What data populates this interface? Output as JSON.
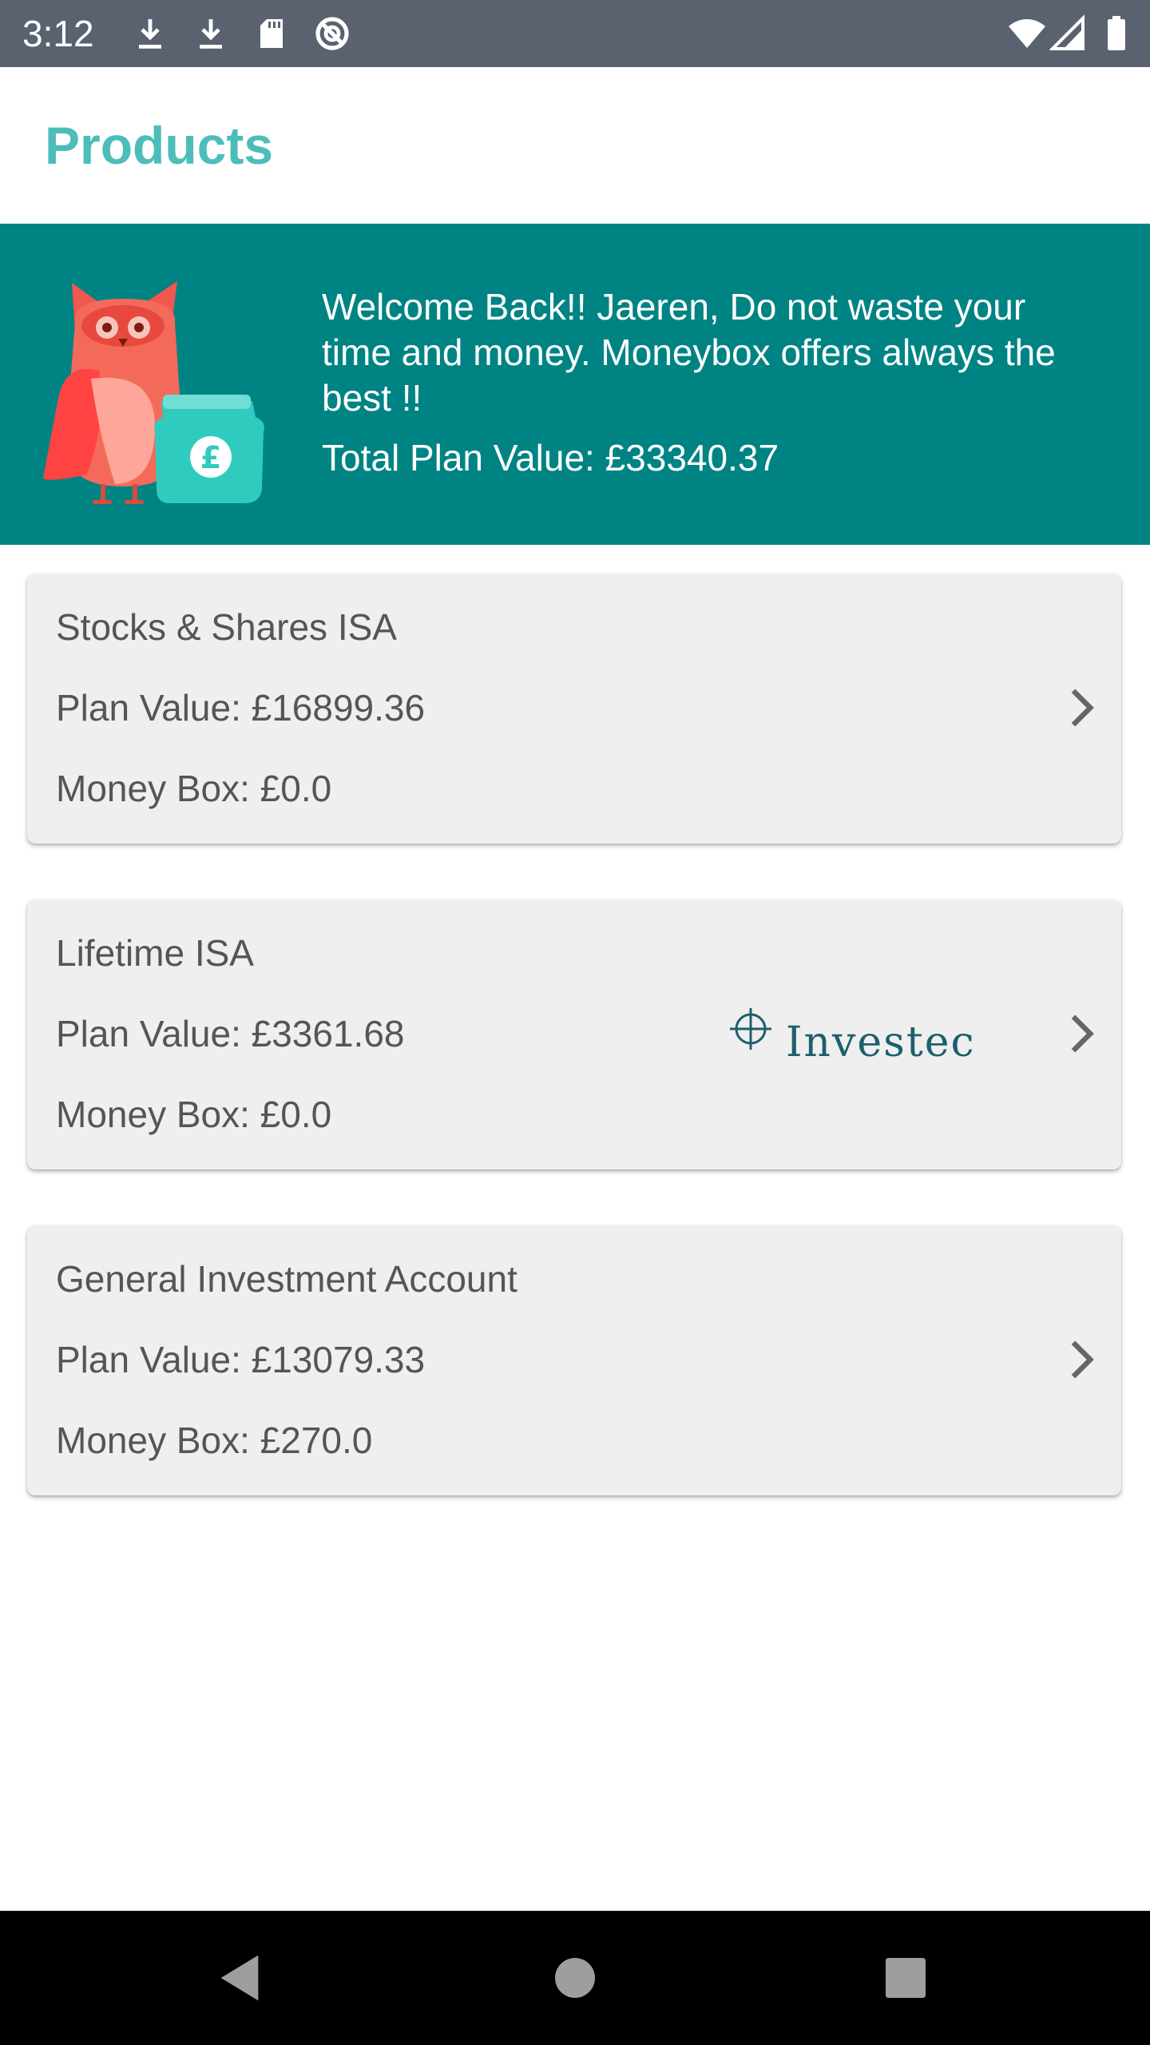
{
  "status_bar": {
    "time": "3:12",
    "icons_left": [
      "download-icon",
      "download-icon",
      "sd-card-icon",
      "data-saver-icon"
    ],
    "icons_right": [
      "wifi-icon",
      "signal-icon",
      "battery-icon"
    ]
  },
  "app_bar": {
    "title": "Products"
  },
  "banner": {
    "message": "Welcome Back!! Jaeren, Do not waste your time and money. Moneybox offers always the best !!",
    "total_plan_value": "Total Plan Value: £33340.37",
    "owl_badge_symbol": "£"
  },
  "products": [
    {
      "name": "Stocks & Shares ISA",
      "plan_value": "Plan Value: £16899.36",
      "money_box": "Money Box: £0.0"
    },
    {
      "name": "Lifetime ISA",
      "plan_value": "Plan Value: £3361.68",
      "money_box": "Money Box: £0.0",
      "provider_logo": "Investec"
    },
    {
      "name": "General Investment Account",
      "plan_value": "Plan Value: £13079.33",
      "money_box": "Money Box: £270.0"
    }
  ],
  "colors": {
    "status_bar": "#5a6270",
    "title": "#4dbdba",
    "banner": "#008383",
    "card": "#efefef",
    "card_text": "#555555",
    "investec": "#1d5f6e"
  }
}
